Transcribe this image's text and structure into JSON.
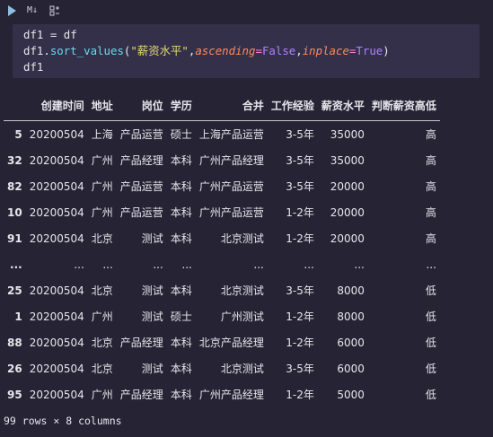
{
  "toolbar": {
    "run_icon": "play-icon",
    "markdown_label": "M↓",
    "variables_icon": "variables-icon"
  },
  "code": {
    "line1": "df1 = df",
    "line2_obj": "df1.",
    "line2_fn": "sort_values",
    "line2_open": "(",
    "line2_str": "\"薪资水平\"",
    "line2_comma1": ",",
    "line2_kw1": "ascending",
    "line2_eq1": "=",
    "line2_val1": "False",
    "line2_comma2": ",",
    "line2_kw2": "inplace",
    "line2_eq2": "=",
    "line2_val2": "True",
    "line2_close": ")",
    "line3": "df1"
  },
  "table": {
    "columns": [
      "",
      "创建时间",
      "地址",
      "岗位",
      "学历",
      "合并",
      "工作经验",
      "薪资水平",
      "判断薪资高低"
    ],
    "rows": [
      [
        "5",
        "20200504",
        "上海",
        "产品运营",
        "硕士",
        "上海产品运营",
        "3-5年",
        "35000",
        "高"
      ],
      [
        "32",
        "20200504",
        "广州",
        "产品经理",
        "本科",
        "广州产品经理",
        "3-5年",
        "35000",
        "高"
      ],
      [
        "82",
        "20200504",
        "广州",
        "产品运营",
        "本科",
        "广州产品运营",
        "3-5年",
        "20000",
        "高"
      ],
      [
        "10",
        "20200504",
        "广州",
        "产品运营",
        "本科",
        "广州产品运营",
        "1-2年",
        "20000",
        "高"
      ],
      [
        "91",
        "20200504",
        "北京",
        "测试",
        "本科",
        "北京测试",
        "1-2年",
        "20000",
        "高"
      ],
      [
        "...",
        "...",
        "...",
        "...",
        "...",
        "...",
        "...",
        "...",
        "..."
      ],
      [
        "25",
        "20200504",
        "北京",
        "测试",
        "本科",
        "北京测试",
        "3-5年",
        "8000",
        "低"
      ],
      [
        "1",
        "20200504",
        "广州",
        "测试",
        "硕士",
        "广州测试",
        "1-2年",
        "8000",
        "低"
      ],
      [
        "88",
        "20200504",
        "北京",
        "产品经理",
        "本科",
        "北京产品经理",
        "1-2年",
        "6000",
        "低"
      ],
      [
        "26",
        "20200504",
        "北京",
        "测试",
        "本科",
        "北京测试",
        "3-5年",
        "6000",
        "低"
      ],
      [
        "95",
        "20200504",
        "广州",
        "产品经理",
        "本科",
        "广州产品经理",
        "1-2年",
        "5000",
        "低"
      ]
    ]
  },
  "footer": "99 rows × 8 columns"
}
